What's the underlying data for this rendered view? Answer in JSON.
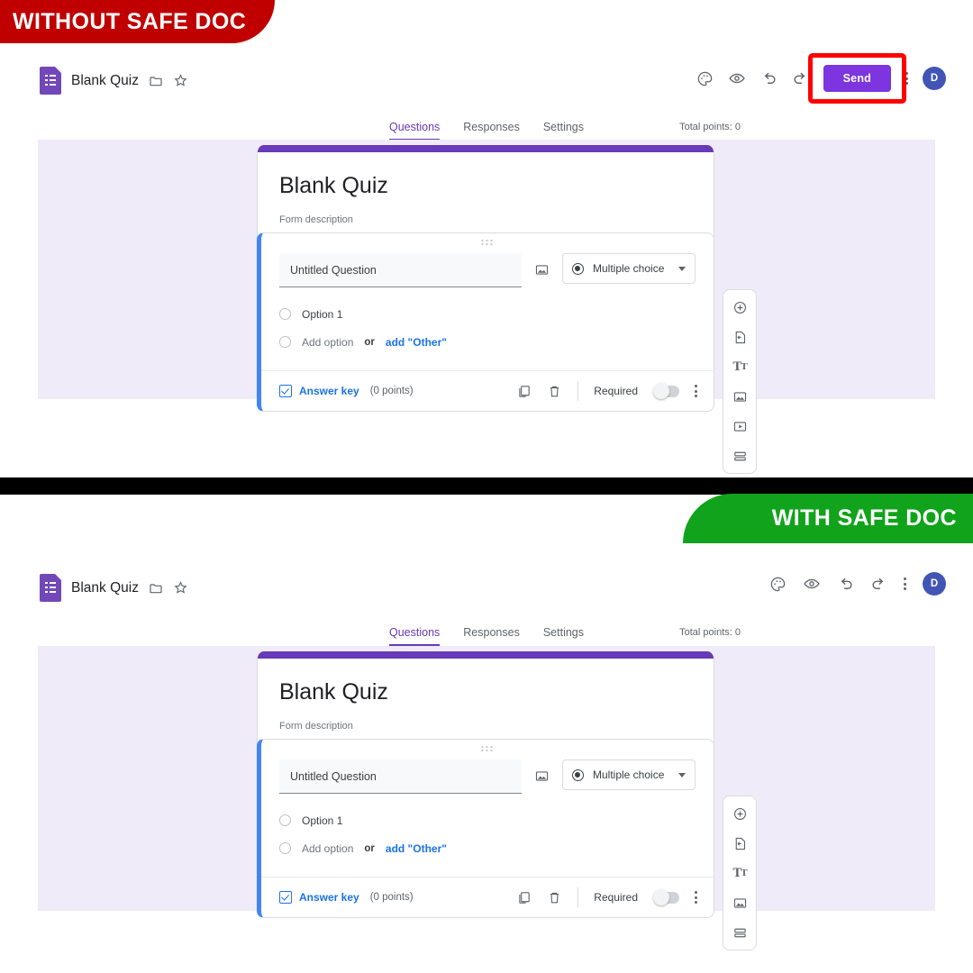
{
  "banners": {
    "without": {
      "label": "WITHOUT SAFE DOC",
      "color": "#c00000"
    },
    "with": {
      "label": "WITH SAFE DOC",
      "color": "#11a31b"
    }
  },
  "app": {
    "doc_title": "Blank Quiz",
    "icons": {
      "forms": "google-forms-icon",
      "folder": "folder-icon",
      "star": "star-icon",
      "palette": "palette-icon",
      "preview": "eye-preview-icon",
      "undo": "undo-icon",
      "redo": "redo-icon",
      "more": "more-vertical-icon"
    },
    "send_label": "Send",
    "avatar_initial": "D",
    "accent_purple": "#673ab7",
    "send_purple": "#7c35df",
    "avatar_color": "#4255b5",
    "highlight_color": "#ff0000"
  },
  "tabs": [
    {
      "label": "Questions",
      "active": true
    },
    {
      "label": "Responses",
      "active": false
    },
    {
      "label": "Settings",
      "active": false
    }
  ],
  "total_points": "Total points: 0",
  "form": {
    "title": "Blank Quiz",
    "description": "Form description"
  },
  "question": {
    "text": "Untitled Question",
    "type": "Multiple choice",
    "options": [
      {
        "label": "Option 1"
      }
    ],
    "add_option": "Add option",
    "or_text": "or",
    "add_other": "add \"Other\"",
    "answer_key": "Answer key",
    "points": "(0 points)",
    "required": "Required",
    "icons": {
      "image": "image-icon",
      "duplicate": "duplicate-icon",
      "delete": "trash-icon",
      "more": "more-vertical-icon",
      "drag": "drag-handle-icon"
    }
  },
  "side_tools_top": [
    "add-question-icon",
    "import-questions-icon",
    "add-title-icon",
    "add-image-icon",
    "add-video-icon",
    "add-section-icon"
  ],
  "side_tools_bottom": [
    "add-question-icon",
    "import-questions-icon",
    "add-title-icon",
    "add-image-icon",
    "add-section-icon"
  ]
}
